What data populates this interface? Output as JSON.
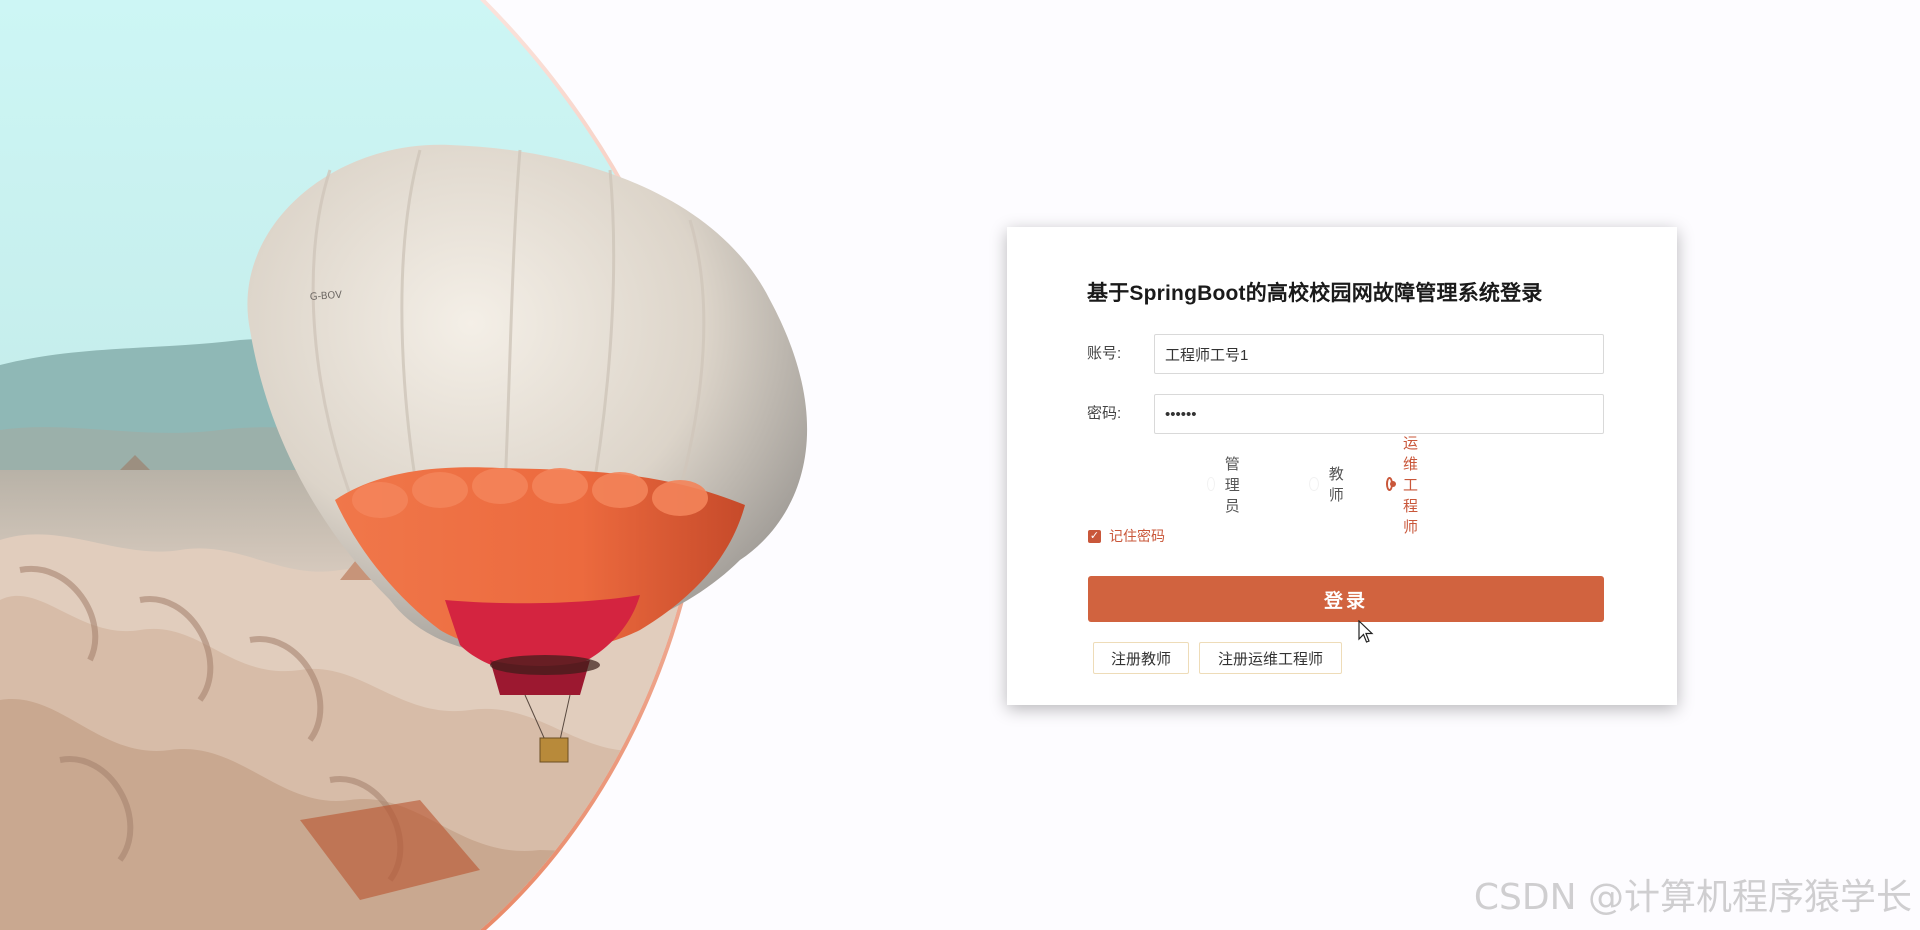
{
  "login": {
    "title": "基于SpringBoot的高校校园网故障管理系统登录",
    "account_label": "账号:",
    "account_value": "工程师工号1",
    "password_label": "密码:",
    "password_value": "••••••",
    "roles": [
      {
        "label": "管理员",
        "checked": false
      },
      {
        "label": "教师",
        "checked": false
      },
      {
        "label": "运维工程师",
        "checked": true
      }
    ],
    "remember_label": "记住密码",
    "remember_checked": true,
    "submit_label": "登录",
    "register_teacher_label": "注册教师",
    "register_engineer_label": "注册运维工程师"
  },
  "hero": {
    "balloon_marking": "G-BOV"
  },
  "watermark": "CSDN @计算机程序猿学长",
  "colors": {
    "accent": "#d1633f",
    "accent_text": "#c9573a",
    "page_background": "#fdfcff",
    "card_background": "#ffffff"
  }
}
